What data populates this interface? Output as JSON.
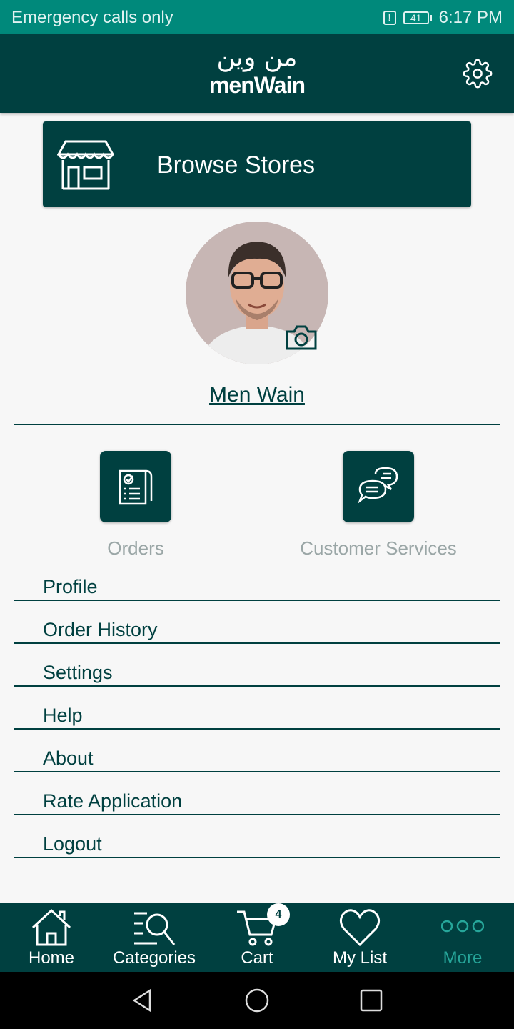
{
  "status_bar": {
    "carrier_text": "Emergency calls only",
    "battery_level": "41",
    "time": "6:17 PM"
  },
  "app_bar": {
    "logo_arabic": "من وين",
    "logo_english": "menWain"
  },
  "browse_button": {
    "label": "Browse Stores"
  },
  "profile": {
    "name": "Men Wain"
  },
  "quick_actions": [
    {
      "label": "Orders"
    },
    {
      "label": "Customer Services"
    }
  ],
  "menu": [
    {
      "label": "Profile"
    },
    {
      "label": "Order History"
    },
    {
      "label": "Settings"
    },
    {
      "label": "Help"
    },
    {
      "label": "About"
    },
    {
      "label": "Rate Application"
    },
    {
      "label": "Logout"
    }
  ],
  "bottom_nav": [
    {
      "label": "Home",
      "icon": "home-icon"
    },
    {
      "label": "Categories",
      "icon": "categories-icon"
    },
    {
      "label": "Cart",
      "icon": "cart-icon",
      "badge": "4"
    },
    {
      "label": "My List",
      "icon": "heart-icon"
    },
    {
      "label": "More",
      "icon": "more-icon",
      "active": true
    }
  ],
  "colors": {
    "primary": "#004040",
    "status_bar": "#00897b",
    "accent": "#26a69a",
    "muted_text": "#9aa6a6"
  }
}
